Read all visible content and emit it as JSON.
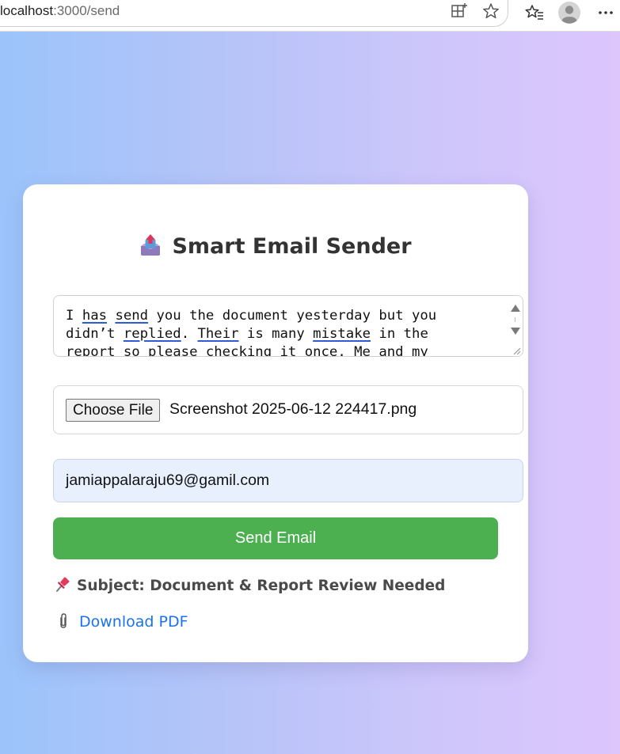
{
  "browser": {
    "url_host": "localhost",
    "url_path": ":3000/send",
    "icons": [
      "reload-icon",
      "split-screen-icon",
      "favorites-star-icon",
      "favorites-list-icon",
      "profile-avatar-icon",
      "more-menu-icon"
    ]
  },
  "page": {
    "background_gradient": [
      "#9bc4fb",
      "#dcc6fc"
    ]
  },
  "card": {
    "title": "Smart Email Sender",
    "title_icon": "outbox-tray-icon",
    "message": {
      "parts": [
        {
          "text": "I ",
          "spell": false
        },
        {
          "text": "has",
          "spell": true
        },
        {
          "text": " ",
          "spell": false
        },
        {
          "text": "send",
          "spell": true
        },
        {
          "text": " you the document yesterday but you\ndidn’t ",
          "spell": false
        },
        {
          "text": "replied",
          "spell": true
        },
        {
          "text": ". ",
          "spell": false
        },
        {
          "text": "Their",
          "spell": true
        },
        {
          "text": " is many ",
          "spell": false
        },
        {
          "text": "mistake",
          "spell": true
        },
        {
          "text": " in the\nreport so please checking it once. Me and my",
          "spell": false
        }
      ]
    },
    "file_input": {
      "button_label": "Choose File",
      "file_name": "Screenshot 2025-06-12 224417.png"
    },
    "email_input": {
      "value": "jamiappalaraju69@gamil.com",
      "background": "#e8f0fe"
    },
    "send_button": {
      "label": "Send Email",
      "color": "#4caf50"
    },
    "subject": {
      "icon": "pushpin-icon",
      "text": "Subject: Document & Report Review Needed"
    },
    "download": {
      "icon": "paperclip-icon",
      "label": "Download PDF",
      "color": "#1a73e8"
    }
  }
}
